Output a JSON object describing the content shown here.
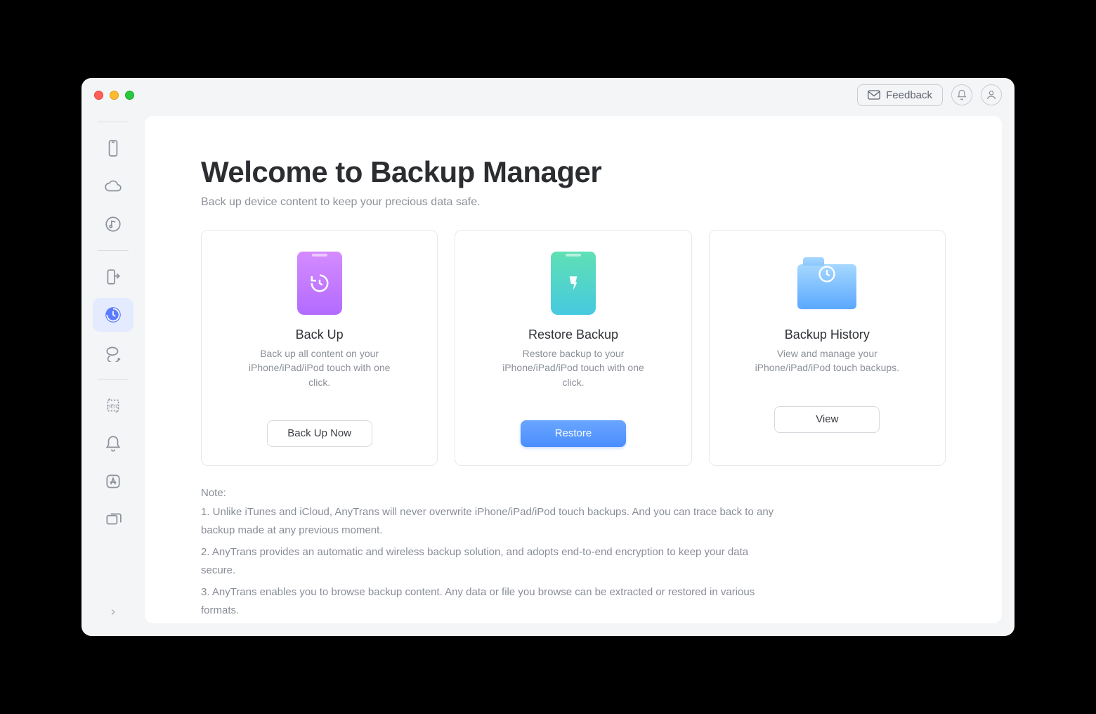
{
  "header": {
    "feedback_label": "Feedback"
  },
  "sidebar": {
    "items": [
      {
        "name": "device"
      },
      {
        "name": "icloud"
      },
      {
        "name": "media"
      },
      {
        "name": "phone-switch"
      },
      {
        "name": "backup",
        "active": true
      },
      {
        "name": "social"
      },
      {
        "name": "heic"
      },
      {
        "name": "ringtone"
      },
      {
        "name": "app-store"
      },
      {
        "name": "mirror"
      }
    ]
  },
  "main": {
    "title": "Welcome to Backup Manager",
    "subtitle": "Back up device content to keep your precious data safe.",
    "cards": [
      {
        "title": "Back Up",
        "desc": "Back up all content on your iPhone/iPad/iPod touch with one click.",
        "button": "Back Up Now"
      },
      {
        "title": "Restore Backup",
        "desc": "Restore backup to your iPhone/iPad/iPod touch with one click.",
        "button": "Restore"
      },
      {
        "title": "Backup History",
        "desc": "View and manage your iPhone/iPad/iPod touch backups.",
        "button": "View"
      }
    ],
    "notes": {
      "header": "Note:",
      "items": [
        "1. Unlike iTunes and iCloud, AnyTrans will never overwrite iPhone/iPad/iPod touch backups. And you can trace back to any backup made at any previous moment.",
        "2. AnyTrans provides an automatic and wireless backup solution, and adopts end-to-end encryption to keep your data secure.",
        "3. AnyTrans enables you to browse backup content. Any data or file you browse can be extracted or restored in various formats."
      ]
    }
  }
}
